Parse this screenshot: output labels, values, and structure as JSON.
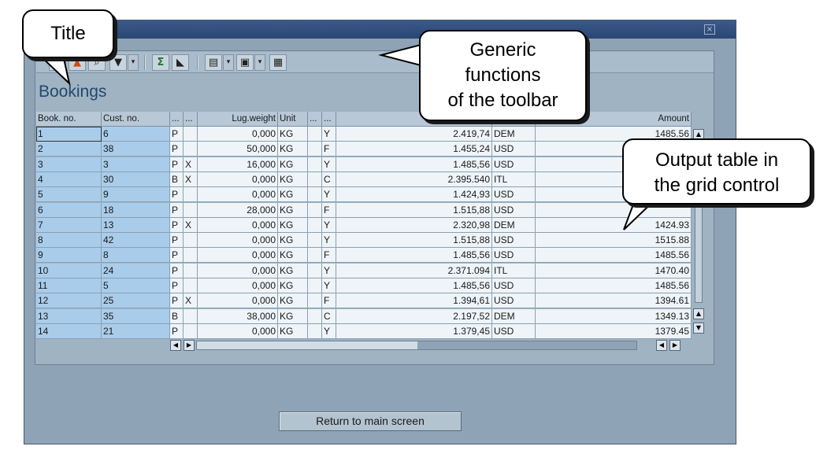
{
  "window": {
    "close_glyph": "×"
  },
  "toolbar": {
    "buttons": [
      {
        "icon": "detail-icon",
        "glyph": "▭"
      },
      {
        "icon": "sort-ascending-icon",
        "glyph": "▲"
      },
      {
        "icon": "find-icon",
        "glyph": "⌕"
      },
      {
        "icon": "filter-icon",
        "glyph": "▼"
      },
      {
        "icon": "sum-icon",
        "glyph": "Σ"
      },
      {
        "icon": "subtotal-icon",
        "glyph": "◣"
      },
      {
        "icon": "print-icon",
        "glyph": "▤"
      },
      {
        "icon": "export-icon",
        "glyph": "▣"
      },
      {
        "icon": "layout-icon",
        "glyph": "▦"
      }
    ],
    "dropdown_glyph": "▾"
  },
  "grid": {
    "title": "Bookings",
    "columns": [
      "Book. no.",
      "Cust. no.",
      "...",
      "...",
      "Lug.weight",
      "Unit",
      "...",
      "...",
      "",
      "",
      "Amount"
    ],
    "rows": [
      [
        "1",
        "6",
        "P",
        "",
        "0,000",
        "KG",
        "",
        "Y",
        "2.419,74",
        "DEM",
        "1485.56"
      ],
      [
        "2",
        "38",
        "P",
        "",
        "50,000",
        "KG",
        "",
        "F",
        "1.455,24",
        "USD",
        ""
      ],
      [
        "3",
        "3",
        "P",
        "X",
        "16,000",
        "KG",
        "",
        "Y",
        "1.485,56",
        "USD",
        ""
      ],
      [
        "4",
        "30",
        "B",
        "X",
        "0,000",
        "KG",
        "",
        "C",
        "2.395.540",
        "ITL",
        ""
      ],
      [
        "5",
        "9",
        "P",
        "",
        "0,000",
        "KG",
        "",
        "Y",
        "1.424,93",
        "USD",
        ""
      ],
      [
        "6",
        "18",
        "P",
        "",
        "28,000",
        "KG",
        "",
        "F",
        "1.515,88",
        "USD",
        ""
      ],
      [
        "7",
        "13",
        "P",
        "X",
        "0,000",
        "KG",
        "",
        "Y",
        "2.320,98",
        "DEM",
        "1424.93"
      ],
      [
        "8",
        "42",
        "P",
        "",
        "0,000",
        "KG",
        "",
        "Y",
        "1.515,88",
        "USD",
        "1515.88"
      ],
      [
        "9",
        "8",
        "P",
        "",
        "0,000",
        "KG",
        "",
        "F",
        "1.485,56",
        "USD",
        "1485.56"
      ],
      [
        "10",
        "24",
        "P",
        "",
        "0,000",
        "KG",
        "",
        "Y",
        "2.371.094",
        "ITL",
        "1470.40"
      ],
      [
        "11",
        "5",
        "P",
        "",
        "0,000",
        "KG",
        "",
        "Y",
        "1.485,56",
        "USD",
        "1485.56"
      ],
      [
        "12",
        "25",
        "P",
        "X",
        "0,000",
        "KG",
        "",
        "F",
        "1.394,61",
        "USD",
        "1394.61"
      ],
      [
        "13",
        "35",
        "B",
        "",
        "38,000",
        "KG",
        "",
        "C",
        "2.197,52",
        "DEM",
        "1349.13"
      ],
      [
        "14",
        "21",
        "P",
        "",
        "0,000",
        "KG",
        "",
        "Y",
        "1.379,45",
        "USD",
        "1379.45"
      ]
    ]
  },
  "scroll": {
    "up": "▲",
    "down": "▼",
    "left": "◀",
    "right": "▶"
  },
  "footer": {
    "return_label": "Return to main screen"
  },
  "callouts": {
    "title": "Title",
    "toolbar": [
      "Generic",
      "functions",
      "of the toolbar"
    ],
    "grid": [
      "Output table in",
      "the grid control"
    ]
  }
}
